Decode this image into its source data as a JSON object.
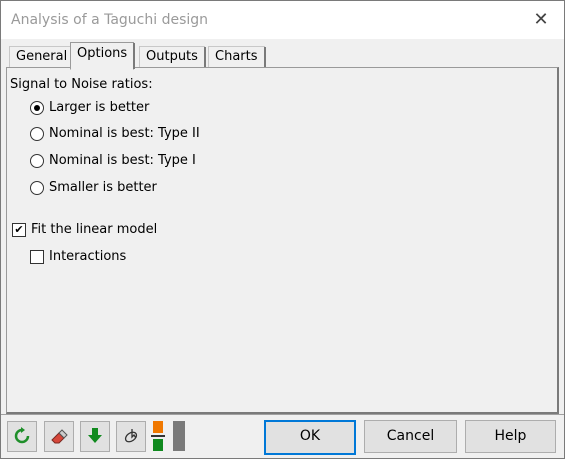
{
  "window": {
    "title": "Analysis of a Taguchi design",
    "close_glyph": "✕"
  },
  "tabs": [
    {
      "label": "General",
      "active": false
    },
    {
      "label": "Options",
      "active": true
    },
    {
      "label": "Outputs",
      "active": false
    },
    {
      "label": "Charts",
      "active": false
    }
  ],
  "options": {
    "sn_label": "Signal to Noise ratios:",
    "sn_choices": [
      {
        "label": "Larger is better",
        "selected": true
      },
      {
        "label": "Nominal is best: Type II",
        "selected": false
      },
      {
        "label": "Nominal is best: Type I",
        "selected": false
      },
      {
        "label": "Smaller is better",
        "selected": false
      }
    ],
    "fit_linear": {
      "label": "Fit the linear model",
      "checked": true,
      "mark": "✔"
    },
    "interactions": {
      "label": "Interactions",
      "checked": false
    }
  },
  "toolbar": {
    "icons": [
      {
        "name": "reset-icon",
        "color": "#1f8f2a"
      },
      {
        "name": "eraser-icon",
        "color": "#d6473a"
      },
      {
        "name": "download-arrow-icon",
        "color": "#118a1f"
      },
      {
        "name": "select-cursor-icon",
        "color": "#333333"
      },
      {
        "name": "layout-blocks-icon",
        "color": "#f07800"
      }
    ]
  },
  "buttons": {
    "ok": "OK",
    "cancel": "Cancel",
    "help": "Help"
  }
}
